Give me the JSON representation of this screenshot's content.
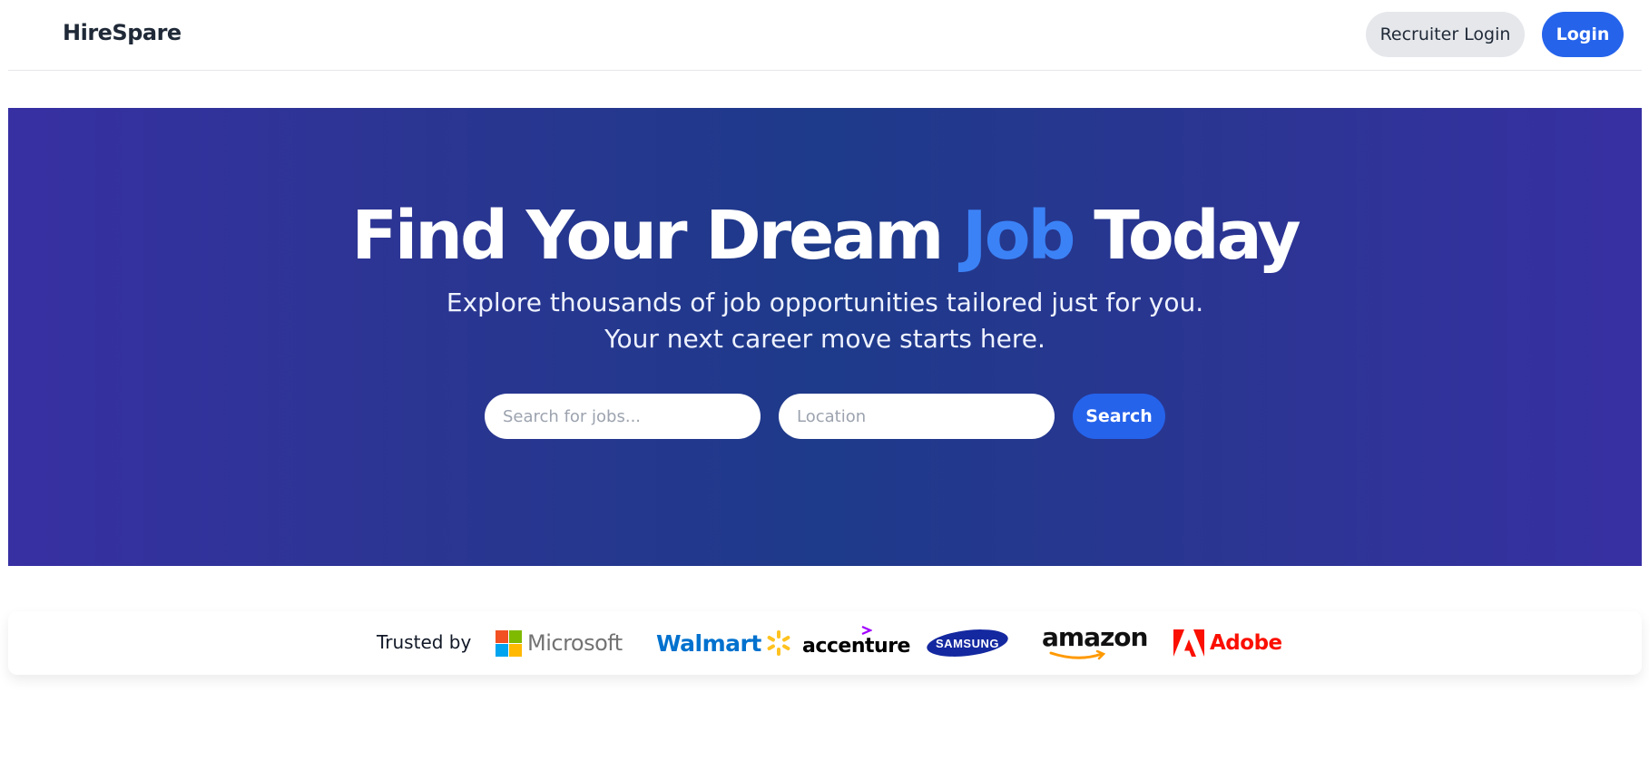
{
  "header": {
    "brand": "HireSpare",
    "recruiter_login_label": "Recruiter Login",
    "login_label": "Login"
  },
  "hero": {
    "title_before": "Find Your Dream ",
    "title_highlight": "Job",
    "title_after": " Today",
    "subtitle_line1": "Explore thousands of job opportunities tailored just for you.",
    "subtitle_line2": "Your next career move starts here.",
    "search_placeholder": "Search for jobs...",
    "location_placeholder": "Location",
    "search_button_label": "Search"
  },
  "trusted": {
    "label": "Trusted by",
    "logos": [
      {
        "name": "Microsoft",
        "icon": "microsoft-logo",
        "color": "#737373"
      },
      {
        "name": "Walmart",
        "icon": "walmart-logo",
        "color": "#0071ce"
      },
      {
        "name": "accenture",
        "icon": "accenture-logo",
        "color": "#000000"
      },
      {
        "name": "SAMSUNG",
        "icon": "samsung-logo",
        "color": "#1428a0"
      },
      {
        "name": "amazon",
        "icon": "amazon-logo",
        "color": "#111111"
      },
      {
        "name": "Adobe",
        "icon": "adobe-logo",
        "color": "#fa0f00"
      }
    ]
  },
  "colors": {
    "accent": "#2563eb",
    "title_highlight": "#3b82f6",
    "hero_gradient_edge": "#3730a3",
    "hero_gradient_center": "#1e3a8a"
  }
}
